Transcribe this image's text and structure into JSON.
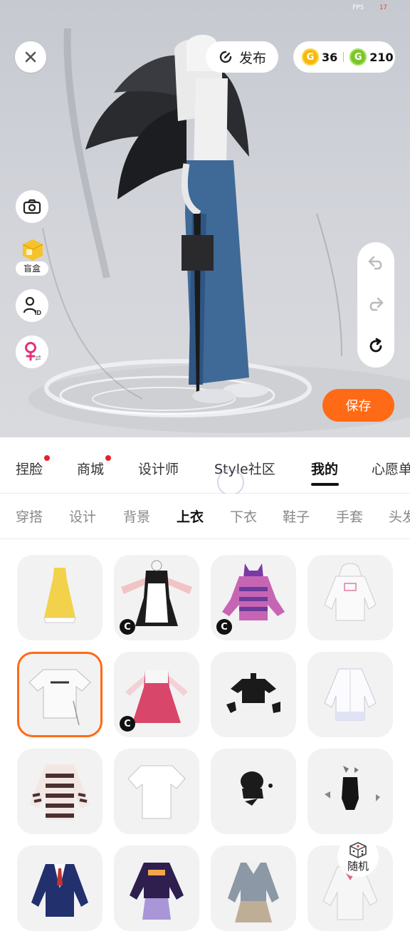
{
  "status": {
    "fps_label": "FPS",
    "fps_value": "17"
  },
  "topbar": {
    "publish_label": "发布",
    "gold_coins": "36",
    "green_coins": "210"
  },
  "side_tools": {
    "blindbox_label": "盲盒"
  },
  "actions": {
    "save_label": "保存"
  },
  "category_tabs": [
    {
      "label": "捏脸",
      "dot": true
    },
    {
      "label": "商城",
      "dot": true
    },
    {
      "label": "设计师",
      "dot": false
    },
    {
      "label": "Style社区",
      "dot": false
    },
    {
      "label": "我的",
      "dot": false,
      "active": true
    },
    {
      "label": "心愿单",
      "dot": false
    }
  ],
  "sub_tabs": [
    {
      "label": "穿搭"
    },
    {
      "label": "设计"
    },
    {
      "label": "背景"
    },
    {
      "label": "上衣",
      "active": true
    },
    {
      "label": "下衣"
    },
    {
      "label": "鞋子"
    },
    {
      "label": "手套"
    },
    {
      "label": "头发"
    }
  ],
  "items": [
    {
      "name": "yellow-dress",
      "badge": false
    },
    {
      "name": "maid-outfit",
      "badge": true
    },
    {
      "name": "purple-cat-hoodie",
      "badge": true
    },
    {
      "name": "white-hoodie",
      "badge": false
    },
    {
      "name": "white-graphic-tee",
      "badge": false,
      "selected": true
    },
    {
      "name": "pink-plaid-dress",
      "badge": true
    },
    {
      "name": "black-crop-top",
      "badge": false
    },
    {
      "name": "white-shirt",
      "badge": false
    },
    {
      "name": "striped-sweater",
      "badge": false
    },
    {
      "name": "white-tshirt",
      "badge": false
    },
    {
      "name": "black-scarf",
      "badge": false
    },
    {
      "name": "black-bodysuit",
      "badge": false
    },
    {
      "name": "navy-blazer",
      "badge": false
    },
    {
      "name": "purple-plaid-outfit",
      "badge": false
    },
    {
      "name": "grey-sailor-uniform",
      "badge": false
    },
    {
      "name": "white-sailor-top",
      "badge": false
    }
  ],
  "random_label": "随机",
  "badge_letter": "C"
}
